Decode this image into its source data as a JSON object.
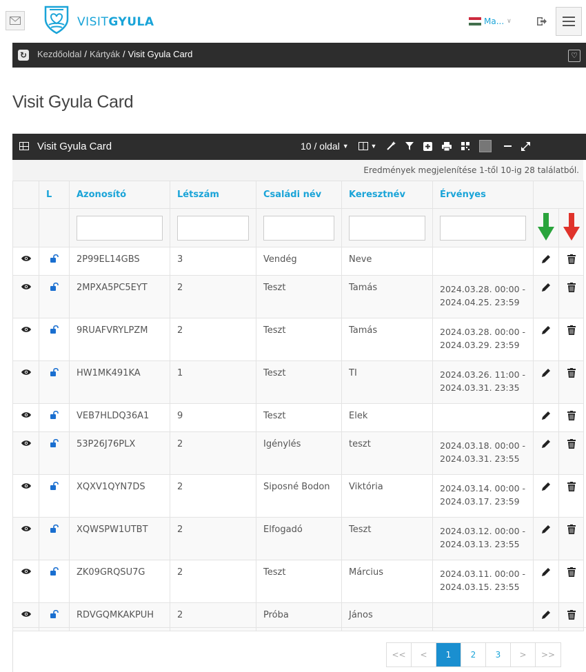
{
  "header": {
    "brand_prefix": "VISIT",
    "brand_suffix": "GYULA",
    "language_label": "Ma...",
    "colors": {
      "brand": "#1aa4d8",
      "bar": "#2d2d2d"
    }
  },
  "breadcrumb": {
    "items": [
      "Kezdőoldal",
      "Kártyák",
      "Visit Gyula Card"
    ],
    "separator": "/"
  },
  "page": {
    "title": "Visit Gyula Card"
  },
  "panel": {
    "title": "Visit Gyula Card",
    "per_page_label": "10 / oldal",
    "result_info": "Eredmények megjelenítése 1-től 10-ig 28 találatból."
  },
  "table": {
    "columns": [
      "",
      "L",
      "Azonosító",
      "Létszám",
      "Családi név",
      "Keresztnév",
      "Érvényes",
      ""
    ],
    "rows": [
      {
        "id": "2P99EL14GBS",
        "count": "3",
        "family": "Vendég",
        "given": "Neve",
        "valid_from": "",
        "valid_to": ""
      },
      {
        "id": "2MPXA5PC5EYT",
        "count": "2",
        "family": "Teszt",
        "given": "Tamás",
        "valid_from": "2024.03.28. 00:00 -",
        "valid_to": "2024.04.25. 23:59"
      },
      {
        "id": "9RUAFVRYLPZM",
        "count": "2",
        "family": "Teszt",
        "given": "Tamás",
        "valid_from": "2024.03.28. 00:00 -",
        "valid_to": "2024.03.29. 23:59"
      },
      {
        "id": "HW1MK491KA",
        "count": "1",
        "family": "Teszt",
        "given": "TI",
        "valid_from": "2024.03.26. 11:00 -",
        "valid_to": "2024.03.31. 23:35"
      },
      {
        "id": "VEB7HLDQ36A1",
        "count": "9",
        "family": "Teszt",
        "given": "Elek",
        "valid_from": "",
        "valid_to": ""
      },
      {
        "id": "53P26J76PLX",
        "count": "2",
        "family": "Igénylés",
        "given": "teszt",
        "valid_from": "2024.03.18. 00:00 -",
        "valid_to": "2024.03.31. 23:55"
      },
      {
        "id": "XQXV1QYN7DS",
        "count": "2",
        "family": "Siposné Bodon",
        "given": "Viktória",
        "valid_from": "2024.03.14. 00:00 -",
        "valid_to": "2024.03.17. 23:59"
      },
      {
        "id": "XQWSPW1UTBT",
        "count": "2",
        "family": "Elfogadó",
        "given": "Teszt",
        "valid_from": "2024.03.12. 00:00 -",
        "valid_to": "2024.03.13. 23:55"
      },
      {
        "id": "ZK09GRQSU7G",
        "count": "2",
        "family": "Teszt",
        "given": "Március",
        "valid_from": "2024.03.11. 00:00 -",
        "valid_to": "2024.03.15. 23:55"
      },
      {
        "id": "RDVGQMKAKPUH",
        "count": "2",
        "family": "Próba",
        "given": "János",
        "valid_from": "",
        "valid_to": ""
      }
    ]
  },
  "pagination": {
    "first": "<<",
    "prev": "<",
    "pages": [
      "1",
      "2",
      "3"
    ],
    "active": "1",
    "next": ">",
    "last": ">>"
  },
  "annotations": {
    "green_arrow_color": "#2aa43c",
    "red_arrow_color": "#e0332b"
  }
}
